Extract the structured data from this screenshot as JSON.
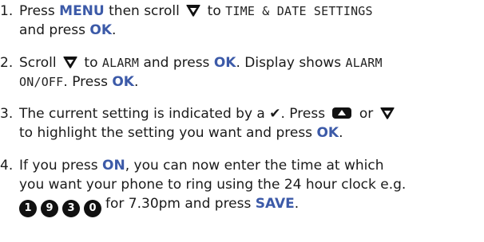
{
  "step1": {
    "number": "1.",
    "text_a": "Press ",
    "kw_menu": "MENU",
    "text_b": " then scroll ",
    "text_c": " to ",
    "lcd_time": "TIME & DATE SETTINGS",
    "text_d": "and press ",
    "kw_ok": "OK",
    "text_e": "."
  },
  "step2": {
    "number": "2.",
    "text_a": "Scroll ",
    "text_b": " to ",
    "lcd_alarm": "ALARM",
    "text_c": " and press ",
    "kw_ok1": "OK",
    "text_d": ". Display shows ",
    "lcd_alarm2": "ALARM",
    "lcd_onoff": "ON/OFF",
    "text_e": ". Press ",
    "kw_ok2": "OK",
    "text_f": "."
  },
  "step3": {
    "number": "3.",
    "text_a": "The current setting is indicated by a ",
    "check": "✔",
    "text_b": ". Press ",
    "text_c": " or ",
    "text_d": "to highlight the setting you want and press ",
    "kw_ok": "OK",
    "text_e": "."
  },
  "step4": {
    "number": "4.",
    "text_a": "If you press ",
    "kw_on": "ON",
    "text_b": ", you can now enter the time at which",
    "line2": "you want your phone to ring using the 24 hour clock e.g.",
    "digits": [
      "1",
      "9",
      "3",
      "0"
    ],
    "text_c": "for 7.30pm and press ",
    "kw_save": "SAVE",
    "text_d": "."
  },
  "icons": {
    "down_key": "down-arrow-key",
    "up_key": "up-arrow-key",
    "keypad_digit": "keypad-digit-key"
  },
  "colors": {
    "keyword": "#3c5aa8"
  }
}
